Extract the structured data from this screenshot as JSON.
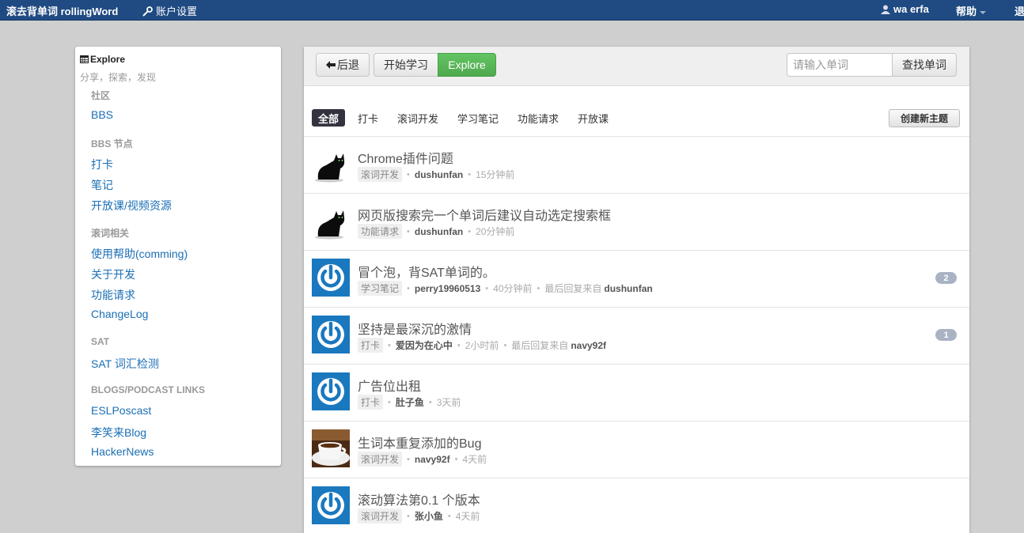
{
  "navbar": {
    "brand": "滚去背单词 rollingWord",
    "settings_label": "账户设置",
    "user_name": "wa erfa",
    "help_label": "帮助",
    "logout_label": "退"
  },
  "sidebar": {
    "title": "Explore",
    "subtitle": "分享，探索，发现",
    "sections": [
      {
        "heading": "社区",
        "links": [
          "BBS"
        ]
      },
      {
        "heading": "BBS 节点",
        "links": [
          "打卡",
          "笔记",
          "开放课/视频资源"
        ]
      },
      {
        "heading": "滚词相关",
        "links": [
          "使用帮助(comming)",
          "关于开发",
          "功能请求",
          "ChangeLog"
        ]
      },
      {
        "heading": "SAT",
        "links": [
          "SAT 词汇检测"
        ]
      },
      {
        "heading": "BLOGS/PODCAST LINKS",
        "links": [
          "ESLPoscast",
          "李笑来Blog",
          "HackerNews"
        ]
      }
    ]
  },
  "toolbar": {
    "back_label": "后退",
    "start_label": "开始学习",
    "explore_label": "Explore",
    "search_placeholder": "请输入单词",
    "search_button": "查找单词"
  },
  "tabs": [
    "全部",
    "打卡",
    "滚词开发",
    "学习笔记",
    "功能请求",
    "开放课"
  ],
  "active_tab": "全部",
  "create_topic_label": "创建新主题",
  "topics": [
    {
      "title": "Chrome插件问题",
      "tag": "滚词开发",
      "author": "dushunfan",
      "time": "15分钟前",
      "avatar": "black-cat",
      "last_reply_label": "",
      "last_reply_user": "",
      "replies": ""
    },
    {
      "title": "网页版搜索完一个单词后建议自动选定搜索框",
      "tag": "功能请求",
      "author": "dushunfan",
      "time": "20分钟前",
      "avatar": "black-cat",
      "last_reply_label": "",
      "last_reply_user": "",
      "replies": ""
    },
    {
      "title": "冒个泡，背SAT单词的。",
      "tag": "学习笔记",
      "author": "perry19960513",
      "time": "40分钟前",
      "avatar": "power",
      "last_reply_label": "最后回复来自",
      "last_reply_user": "dushunfan",
      "replies": "2"
    },
    {
      "title": "坚持是最深沉的激情",
      "tag": "打卡",
      "author": "爱因为在心中",
      "time": "2小时前",
      "avatar": "power",
      "last_reply_label": "最后回复来自",
      "last_reply_user": "navy92f",
      "replies": "1"
    },
    {
      "title": "广告位出租",
      "tag": "打卡",
      "author": "肚子鱼",
      "time": "3天前",
      "avatar": "power",
      "last_reply_label": "",
      "last_reply_user": "",
      "replies": ""
    },
    {
      "title": "生词本重复添加的Bug",
      "tag": "滚词开发",
      "author": "navy92f",
      "time": "4天前",
      "avatar": "coffee",
      "last_reply_label": "",
      "last_reply_user": "",
      "replies": ""
    },
    {
      "title": "滚动算法第0.1 个版本",
      "tag": "滚词开发",
      "author": "张小鱼",
      "time": "4天前",
      "avatar": "power",
      "last_reply_label": "",
      "last_reply_user": "",
      "replies": ""
    }
  ],
  "colors": {
    "navbar": "#1f4a82",
    "link": "#1a6fb5",
    "explore_button": "#5bb75b",
    "active_tab": "#333340",
    "reply_badge": "#a9b3c4"
  }
}
